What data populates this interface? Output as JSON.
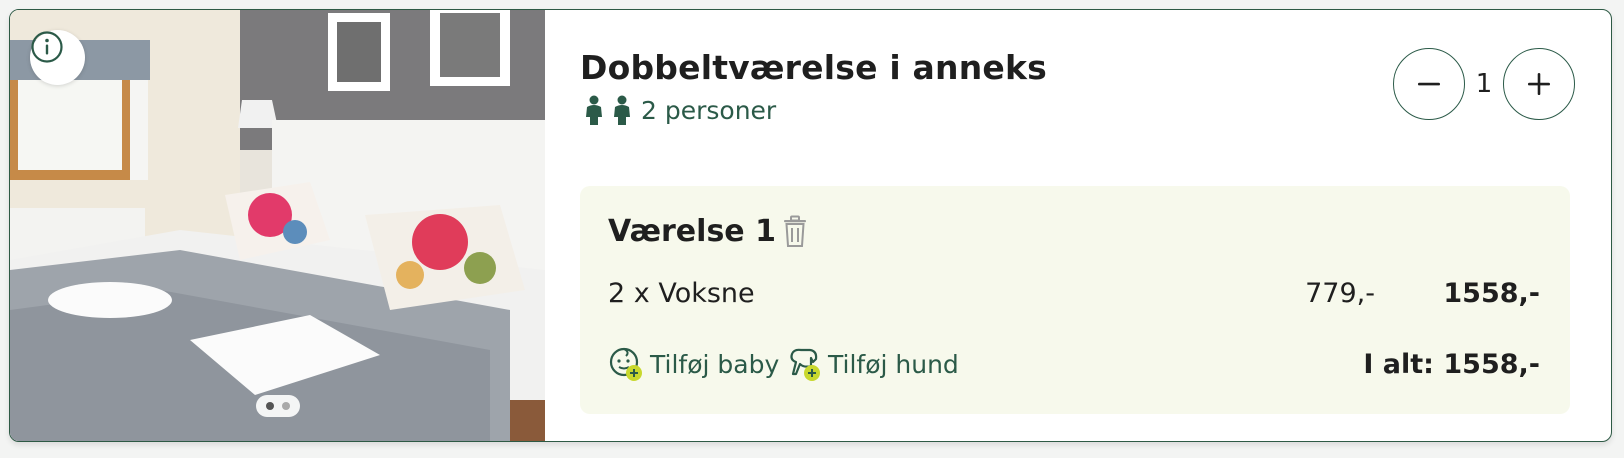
{
  "room": {
    "title": "Dobbeltværelse i anneks",
    "persons_text": "2 personer",
    "photo_alt": "Hotel room with double bed and floral pillows",
    "carousel": {
      "total": 2,
      "active": 1
    }
  },
  "stepper": {
    "minus_label": "−",
    "plus_label": "+",
    "value": "1"
  },
  "booking": {
    "room_label": "Værelse 1",
    "line": {
      "label": "2 x Voksne",
      "unit_price": "779,-",
      "total": "1558,-"
    },
    "add_baby": "Tilføj baby",
    "add_dog": "Tilføj hund",
    "grand_total": "I alt: 1558,-"
  },
  "colors": {
    "accent": "#2b5a48",
    "box_bg": "#f7f9ec",
    "plus_badge": "#c8d82e"
  },
  "icons": [
    "info-icon",
    "person-icon",
    "minus-icon",
    "plus-icon",
    "trash-icon",
    "baby-icon",
    "dog-icon"
  ]
}
